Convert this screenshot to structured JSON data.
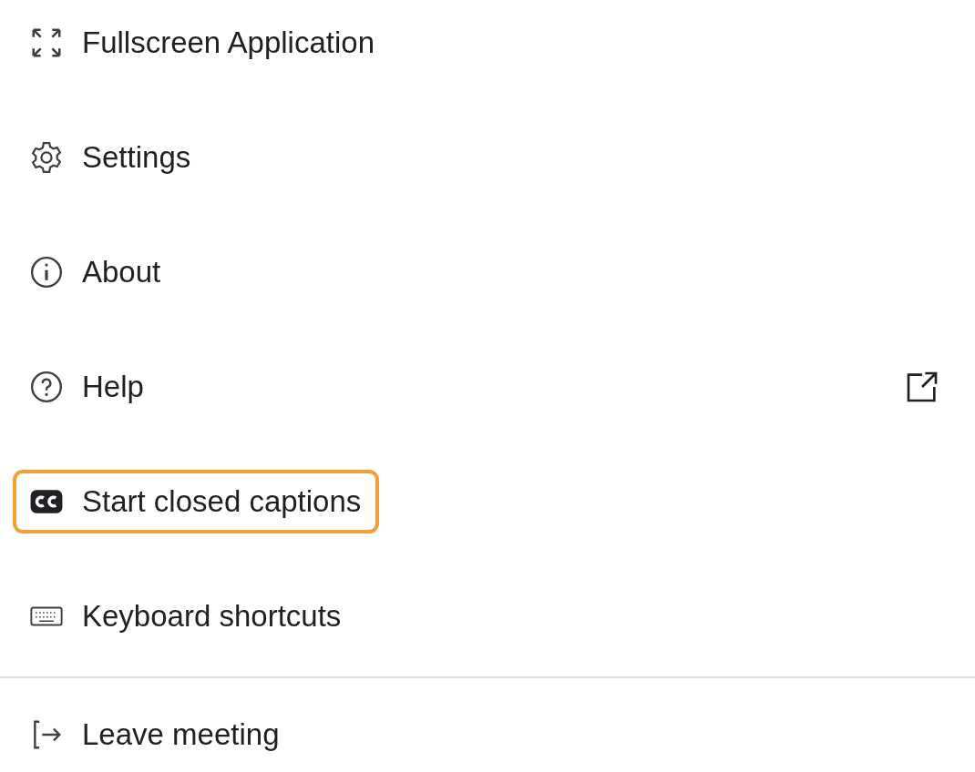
{
  "menu": [
    {
      "kind": "fullscreen",
      "label": "Fullscreen Application",
      "highlighted": false
    },
    {
      "kind": "settings",
      "label": "Settings",
      "highlighted": false
    },
    {
      "kind": "info",
      "label": "About",
      "highlighted": false
    },
    {
      "kind": "help",
      "label": "Help",
      "highlighted": false,
      "external": true
    },
    {
      "kind": "cc",
      "label": "Start closed captions",
      "highlighted": true
    },
    {
      "kind": "keyboard",
      "label": "Keyboard shortcuts",
      "highlighted": false
    },
    {
      "kind": "leave",
      "label": "Leave meeting",
      "highlighted": false,
      "divider_before": true
    }
  ]
}
